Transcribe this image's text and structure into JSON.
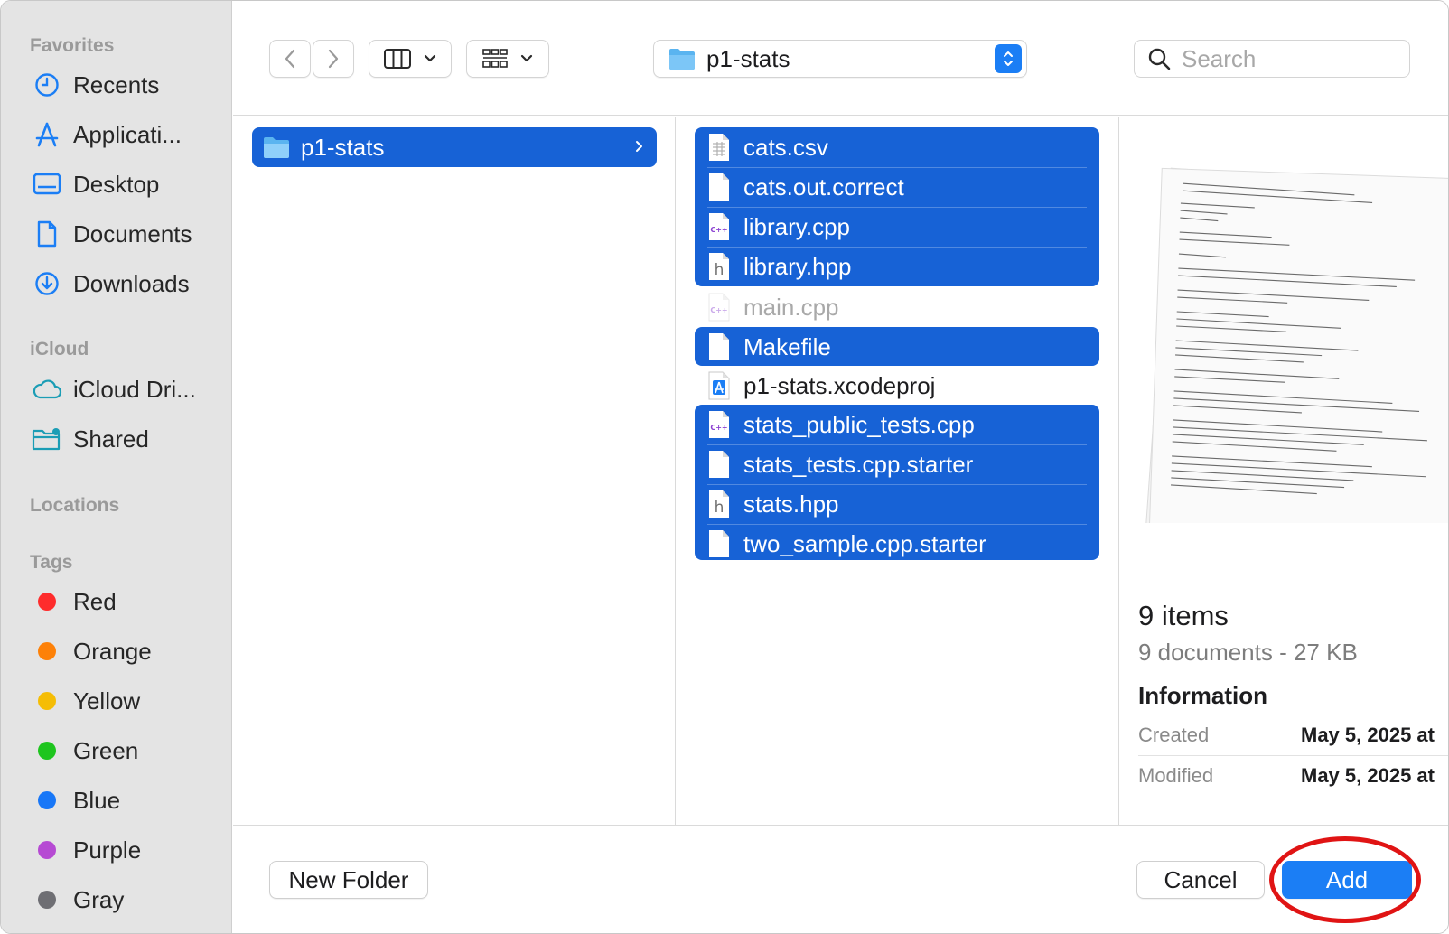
{
  "sidebar": {
    "favorites_header": "Favorites",
    "favorites": [
      {
        "label": "Recents",
        "icon": "clock-icon"
      },
      {
        "label": "Applicati...",
        "icon": "applications-icon"
      },
      {
        "label": "Desktop",
        "icon": "desktop-icon"
      },
      {
        "label": "Documents",
        "icon": "document-icon"
      },
      {
        "label": "Downloads",
        "icon": "downloads-icon"
      }
    ],
    "icloud_header": "iCloud",
    "icloud": [
      {
        "label": "iCloud Dri...",
        "icon": "cloud-icon"
      },
      {
        "label": "Shared",
        "icon": "shared-folder-icon"
      }
    ],
    "locations_header": "Locations",
    "tags_header": "Tags",
    "tags": [
      {
        "label": "Red",
        "color": "#fe2c2c"
      },
      {
        "label": "Orange",
        "color": "#fd8108"
      },
      {
        "label": "Yellow",
        "color": "#f5bd05"
      },
      {
        "label": "Green",
        "color": "#1ec51e"
      },
      {
        "label": "Blue",
        "color": "#1877f7"
      },
      {
        "label": "Purple",
        "color": "#b64ad3"
      },
      {
        "label": "Gray",
        "color": "#6e6e73"
      }
    ]
  },
  "toolbar": {
    "back_icon": "chevron-left-icon",
    "forward_icon": "chevron-right-icon",
    "view_icon": "column-view-icon",
    "group_icon": "grid-group-icon",
    "path_label": "p1-stats",
    "search_placeholder": "Search"
  },
  "column1": {
    "selected_folder": "p1-stats"
  },
  "column2": {
    "files": [
      {
        "name": "cats.csv",
        "type": "csv",
        "selected": true
      },
      {
        "name": "cats.out.correct",
        "type": "blank",
        "selected": true
      },
      {
        "name": "library.cpp",
        "type": "cpp",
        "selected": true
      },
      {
        "name": "library.hpp",
        "type": "h",
        "selected": true
      },
      {
        "name": "main.cpp",
        "type": "cpp",
        "selected": false,
        "dimmed": true
      },
      {
        "name": "Makefile",
        "type": "blank",
        "selected": true
      },
      {
        "name": "p1-stats.xcodeproj",
        "type": "xcodeproj",
        "selected": false
      },
      {
        "name": "stats_public_tests.cpp",
        "type": "cpp",
        "selected": true
      },
      {
        "name": "stats_tests.cpp.starter",
        "type": "blank",
        "selected": true
      },
      {
        "name": "stats.hpp",
        "type": "h",
        "selected": true
      },
      {
        "name": "two_sample.cpp.starter",
        "type": "blank",
        "selected": true
      }
    ]
  },
  "preview": {
    "items_title": "9 items",
    "items_sub": "9 documents - 27 KB",
    "info_title": "Information",
    "created_label": "Created",
    "created_value": "May 5, 2025 at",
    "modified_label": "Modified",
    "modified_value": "May 5, 2025 at"
  },
  "footer": {
    "new_folder": "New Folder",
    "cancel": "Cancel",
    "add": "Add"
  },
  "colors": {
    "selection": "#1762d6",
    "accent": "#1b7ef5",
    "annotation": "#e01414"
  }
}
